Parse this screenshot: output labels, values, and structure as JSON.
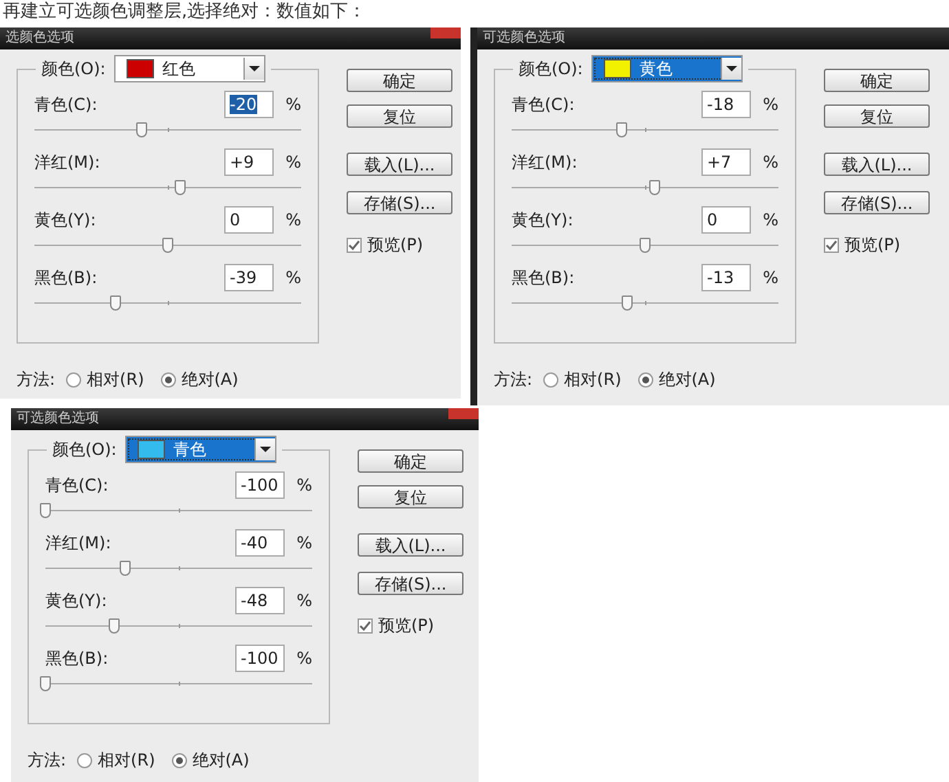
{
  "heading": "再建立可选颜色调整层,选择绝对：数值如下：",
  "dialogs": [
    {
      "title": "选颜色选项",
      "close_button": true,
      "color_label": "颜色(O):",
      "color_select": {
        "value": "红色",
        "color": "#cc0000",
        "focused": false
      },
      "channels": [
        {
          "label": "青色(C):",
          "value": "-20",
          "highlighted": true,
          "unit": "%",
          "level": 0.4
        },
        {
          "label": "洋红(M):",
          "value": "+9",
          "highlighted": false,
          "unit": "%",
          "level": 0.545
        },
        {
          "label": "黄色(Y):",
          "value": "0",
          "highlighted": false,
          "unit": "%",
          "level": 0.5
        },
        {
          "label": "黑色(B):",
          "value": "-39",
          "highlighted": false,
          "unit": "%",
          "level": 0.305
        }
      ],
      "buttons": [
        "确定",
        "复位",
        "载入(L)...",
        "存储(S)..."
      ],
      "preview": {
        "label": "预览(P)",
        "checked": true
      },
      "method": {
        "label": "方法:",
        "options": [
          {
            "label": "相对(R)",
            "selected": false
          },
          {
            "label": "绝对(A)",
            "selected": true
          }
        ]
      }
    },
    {
      "title": "可选颜色选项",
      "close_button": false,
      "color_label": "颜色(O):",
      "color_select": {
        "value": "黄色",
        "color": "#f2f200",
        "focused": true
      },
      "channels": [
        {
          "label": "青色(C):",
          "value": "-18",
          "highlighted": false,
          "unit": "%",
          "level": 0.41
        },
        {
          "label": "洋红(M):",
          "value": "+7",
          "highlighted": false,
          "unit": "%",
          "level": 0.535
        },
        {
          "label": "黄色(Y):",
          "value": "0",
          "highlighted": false,
          "unit": "%",
          "level": 0.5
        },
        {
          "label": "黑色(B):",
          "value": "-13",
          "highlighted": false,
          "unit": "%",
          "level": 0.435
        }
      ],
      "buttons": [
        "确定",
        "复位",
        "载入(L)...",
        "存储(S)..."
      ],
      "preview": {
        "label": "预览(P)",
        "checked": true
      },
      "method": {
        "label": "方法:",
        "options": [
          {
            "label": "相对(R)",
            "selected": false
          },
          {
            "label": "绝对(A)",
            "selected": true
          }
        ]
      }
    },
    {
      "title": "可选颜色选项",
      "close_button": true,
      "color_label": "颜色(O):",
      "color_select": {
        "value": "青色",
        "color": "#33bbee",
        "focused": true
      },
      "channels": [
        {
          "label": "青色(C):",
          "value": "-100",
          "highlighted": false,
          "unit": "%",
          "level": 0
        },
        {
          "label": "洋红(M):",
          "value": "-40",
          "highlighted": false,
          "unit": "%",
          "level": 0.3
        },
        {
          "label": "黄色(Y):",
          "value": "-48",
          "highlighted": false,
          "unit": "%",
          "level": 0.26
        },
        {
          "label": "黑色(B):",
          "value": "-100",
          "highlighted": false,
          "unit": "%",
          "level": 0
        }
      ],
      "buttons": [
        "确定",
        "复位",
        "载入(L)...",
        "存储(S)..."
      ],
      "preview": {
        "label": "预览(P)",
        "checked": true
      },
      "method": {
        "label": "方法:",
        "options": [
          {
            "label": "相对(R)",
            "selected": false
          },
          {
            "label": "绝对(A)",
            "selected": true
          }
        ]
      }
    }
  ]
}
